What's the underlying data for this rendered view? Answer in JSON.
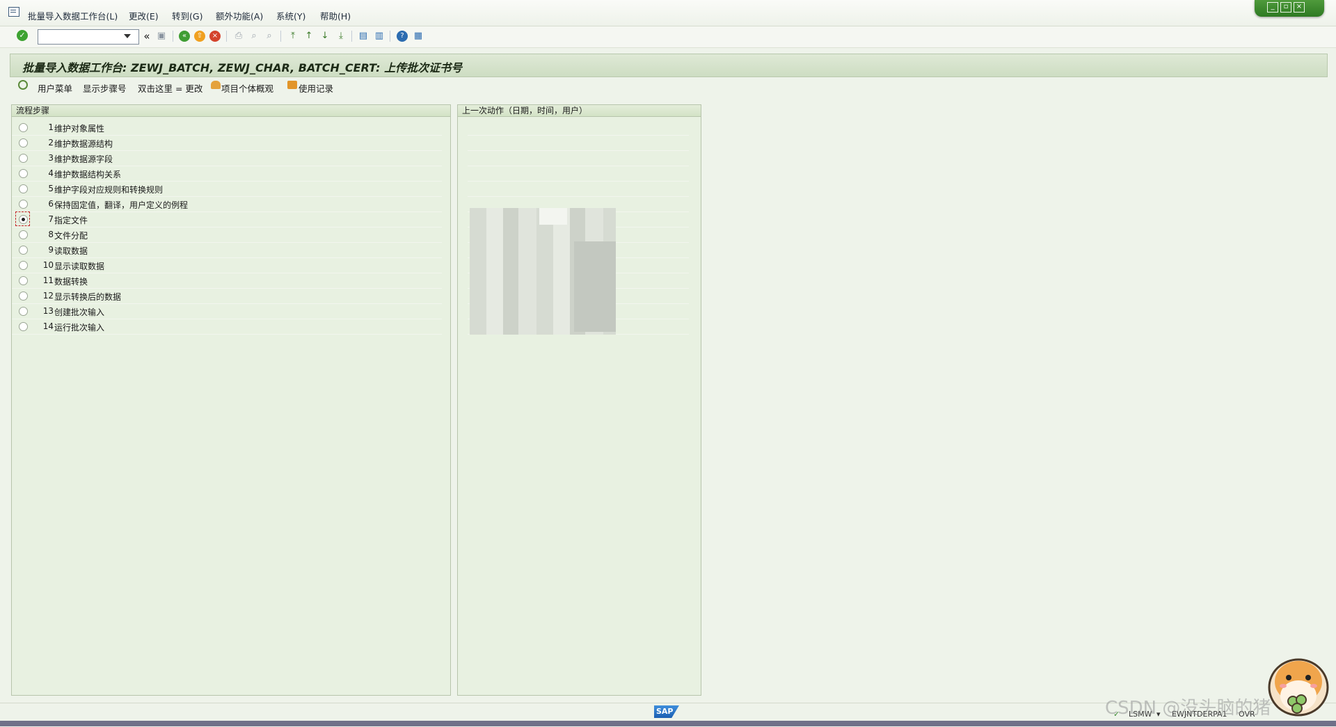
{
  "menubar": {
    "items": [
      "批量导入数据工作台(L)",
      "更改(E)",
      "转到(G)",
      "额外功能(A)",
      "系统(Y)",
      "帮助(H)"
    ]
  },
  "window_controls": [
    "minimize",
    "restore",
    "close"
  ],
  "toolbar": {
    "command_field_value": "",
    "icons": [
      "enter-icon",
      "back-icon",
      "save-icon",
      "back-green-icon",
      "exit-icon",
      "cancel-icon",
      "print-icon",
      "find-icon",
      "find-next-icon",
      "first-page-icon",
      "prev-page-icon",
      "next-page-icon",
      "last-page-icon",
      "create-session-icon",
      "shortcut-icon",
      "help-icon",
      "layout-icon"
    ]
  },
  "title": "批量导入数据工作台: ZEWJ_BATCH, ZEWJ_CHAR, BATCH_CERT: 上传批次证书号",
  "app_toolbar": {
    "user_menu": "用户菜单",
    "show_step_numbers": "显示步骤号",
    "double_click_change": "双击这里 = 更改",
    "project_overview": "项目个体概观",
    "usage_log": "使用记录"
  },
  "steps_panel": {
    "header": "流程步骤",
    "selected_index": 6,
    "steps": [
      {
        "num": "1",
        "label": "维护对象属性"
      },
      {
        "num": "2",
        "label": "维护数据源结构"
      },
      {
        "num": "3",
        "label": "维护数据源字段"
      },
      {
        "num": "4",
        "label": "维护数据结构关系"
      },
      {
        "num": "5",
        "label": "维护字段对应规则和转换规则"
      },
      {
        "num": "6",
        "label": "保持固定值，翻译，用户定义的例程"
      },
      {
        "num": "7",
        "label": "指定文件"
      },
      {
        "num": "8",
        "label": "文件分配"
      },
      {
        "num": "9",
        "label": "读取数据"
      },
      {
        "num": "10",
        "label": "显示读取数据"
      },
      {
        "num": "11",
        "label": "数据转换"
      },
      {
        "num": "12",
        "label": "显示转换后的数据"
      },
      {
        "num": "13",
        "label": "创建批次输入"
      },
      {
        "num": "14",
        "label": "运行批次输入"
      }
    ]
  },
  "last_action_panel": {
    "header": "上一次动作（日期，时间，用户）"
  },
  "statusbar": {
    "transaction": "LSMW",
    "server": "EWJNTDERPA1",
    "mode": "OVR",
    "logo": "SAP"
  },
  "watermark": "CSDN @没头脑的猪"
}
